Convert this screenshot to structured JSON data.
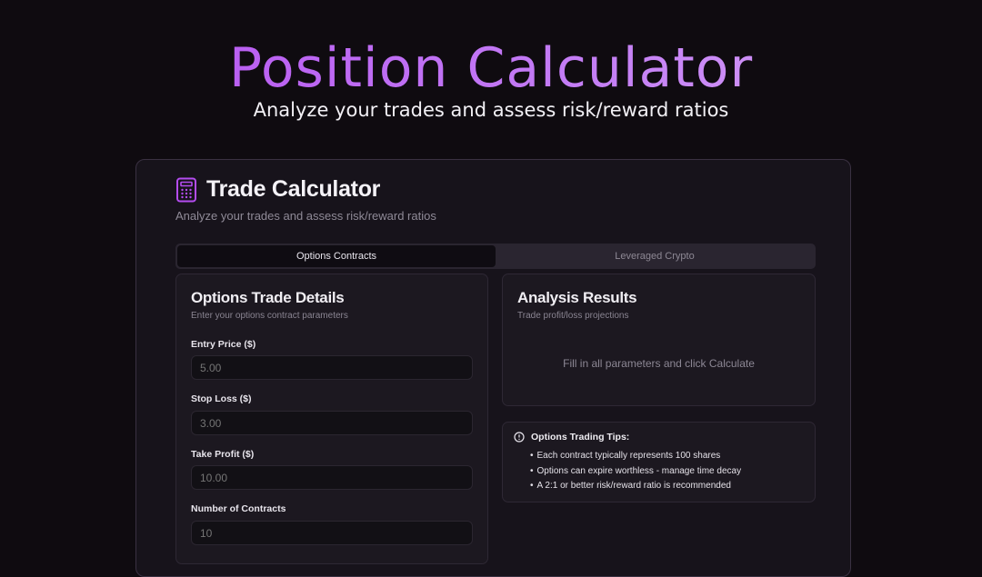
{
  "hero": {
    "title": "Position Calculator",
    "subtitle": "Analyze your trades and assess risk/reward ratios"
  },
  "calculator": {
    "title": "Trade Calculator",
    "subtitle": "Analyze your trades and assess risk/reward ratios",
    "icon": "calculator-icon",
    "tabs": [
      {
        "label": "Options Contracts",
        "active": true
      },
      {
        "label": "Leveraged Crypto",
        "active": false
      }
    ]
  },
  "details": {
    "title": "Options Trade Details",
    "subtitle": "Enter your options contract parameters",
    "fields": [
      {
        "label": "Entry Price ($)",
        "placeholder": "5.00"
      },
      {
        "label": "Stop Loss ($)",
        "placeholder": "3.00"
      },
      {
        "label": "Take Profit ($)",
        "placeholder": "10.00"
      },
      {
        "label": "Number of Contracts",
        "placeholder": "10"
      }
    ]
  },
  "results": {
    "title": "Analysis Results",
    "subtitle": "Trade profit/loss projections",
    "empty_message": "Fill in all parameters and click Calculate"
  },
  "tips": {
    "icon": "info-icon",
    "title": "Options Trading Tips:",
    "items": [
      "Each contract typically represents 100 shares",
      "Options can expire worthless - manage time decay",
      "A 2:1 or better risk/reward ratio is recommended"
    ]
  },
  "colors": {
    "background": "#0f0b10",
    "accent": "#b44cf0",
    "card": "#17131b"
  }
}
